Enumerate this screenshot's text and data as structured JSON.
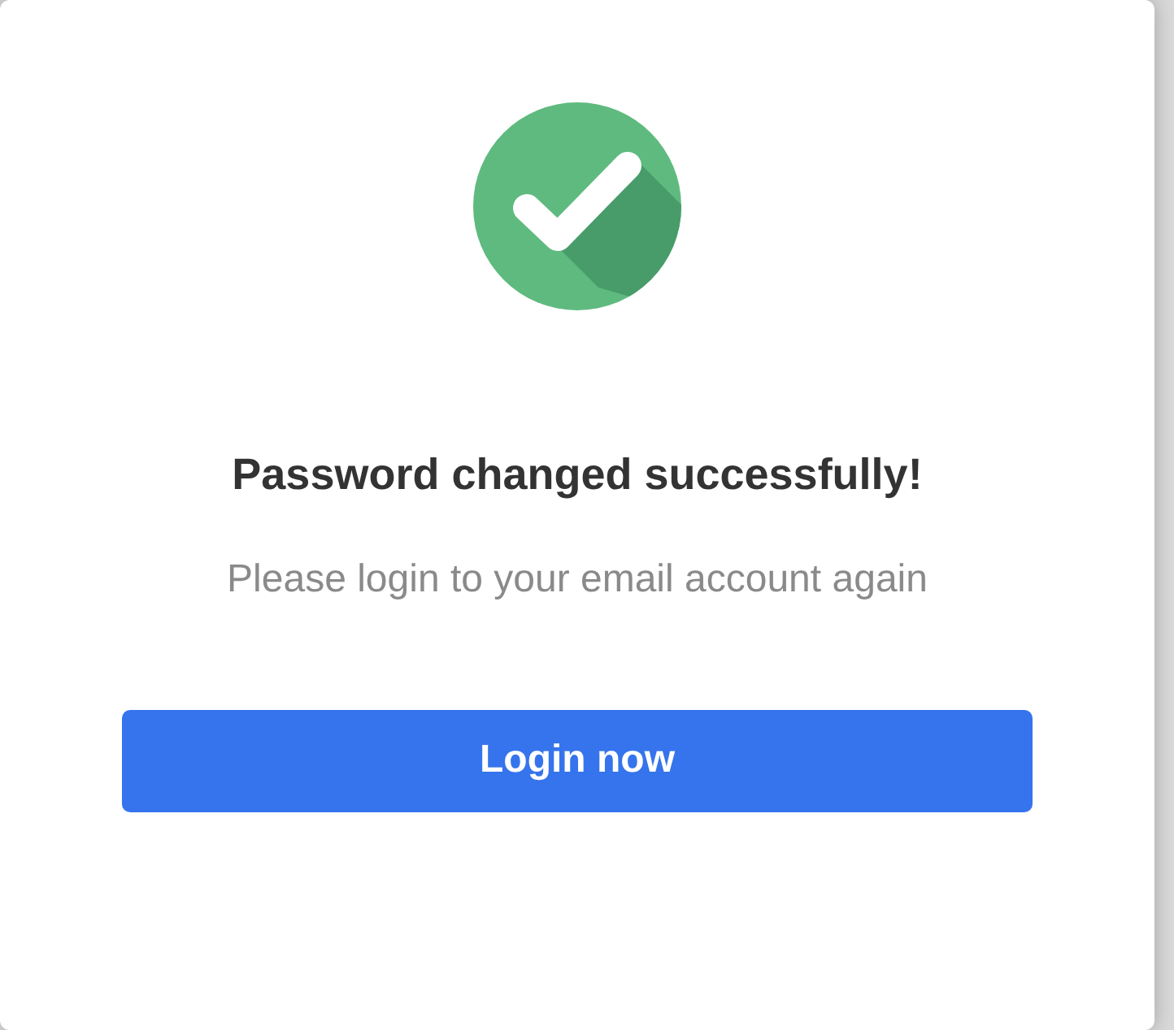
{
  "dialog": {
    "title": "Password changed successfully!",
    "message": "Please login to your email account again",
    "button": "Login now"
  }
}
